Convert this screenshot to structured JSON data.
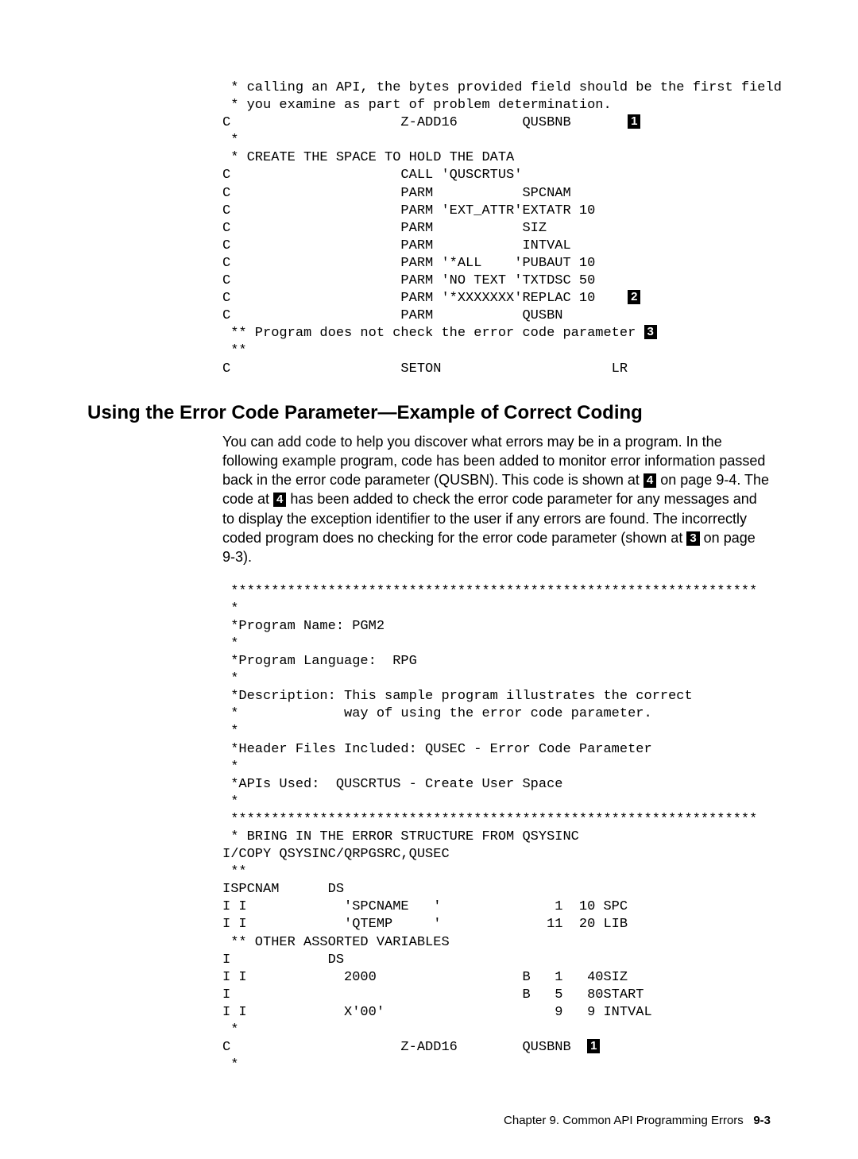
{
  "topCode": {
    "c1": " * calling an API, the bytes provided field should be the first field",
    "c2": " * you examine as part of problem determination.",
    "c3": "C                     Z-ADD16        QUSBNB",
    "c4": " *",
    "c5": " * CREATE THE SPACE TO HOLD THE DATA",
    "c6": "C                     CALL 'QUSCRTUS'",
    "c7": "C                     PARM           SPCNAM",
    "c8": "C                     PARM 'EXT_ATTR'EXTATR 10",
    "c9": "C                     PARM           SIZ",
    "c10": "C                     PARM           INTVAL",
    "c11": "C                     PARM '*ALL    'PUBAUT 10",
    "c12": "C                     PARM 'NO TEXT 'TXTDSC 50",
    "c13": "C                     PARM '*XXXXXXX'REPLAC 10",
    "c14": "C                     PARM           QUSBN",
    "c15": " ** Program does not check the error code parameter ",
    "c16": " **",
    "c17": "C                     SETON                     LR",
    "co1": "1",
    "co2": "2",
    "co3": "3"
  },
  "heading": "Using the Error Code Parameter—Example of Correct Coding",
  "para": {
    "t1": "You can add code to help you discover what errors may be in a program.  In the following example program, code has been added to monitor error information passed back in the error code parameter (QUSBN).  This code is shown at ",
    "t2": " on page 9-4.  The code at ",
    "t3": " has been added to check the error code parameter for any messages and to display the exception identifier to the user if any errors are found.  The incorrectly coded program does no checking for the error code parameter (shown at ",
    "t4": " on page 9-3).",
    "co4a": "4",
    "co4b": "4",
    "co3": "3"
  },
  "bottomCode": {
    "l1": " *****************************************************************",
    "l2": " *",
    "l3": " *Program Name: PGM2",
    "l4": " *",
    "l5": " *Program Language:  RPG",
    "l6": " *",
    "l7": " *Description: This sample program illustrates the correct",
    "l8": " *             way of using the error code parameter.",
    "l9": " *",
    "l10": " *Header Files Included: QUSEC - Error Code Parameter",
    "l11": " *",
    "l12": " *APIs Used:  QUSCRTUS - Create User Space",
    "l13": " *",
    "l14": " *****************************************************************",
    "l15": " * BRING IN THE ERROR STRUCTURE FROM QSYSINC",
    "l16": "I/COPY QSYSINC/QRPGSRC,QUSEC",
    "l17": " **",
    "l18": "ISPCNAM      DS",
    "l19": "I I            'SPCNAME   '              1  10 SPC",
    "l20": "I I            'QTEMP     '             11  20 LIB",
    "l21": " ** OTHER ASSORTED VARIABLES",
    "l22": "I            DS",
    "l23": "I I            2000                  B   1   40SIZ",
    "l24": "I                                    B   5   80START",
    "l25": "I I            X'00'                     9   9 INTVAL",
    "l26": " *",
    "l27": "C                     Z-ADD16        QUSBNB  ",
    "l28": " *",
    "co1": "1"
  },
  "footer": {
    "chapter": "Chapter 9.  Common API Programming Errors",
    "page": "9-3"
  }
}
